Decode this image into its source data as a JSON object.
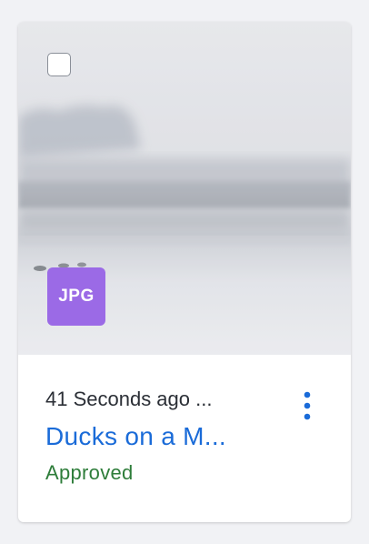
{
  "card": {
    "image_alt": "Ducks on a Misty Lake",
    "file_type_badge": "JPG",
    "timestamp": "41 Seconds ago ...",
    "title": "Ducks on a M...",
    "status": "Approved",
    "more_actions_icon": "vertical-ellipsis-icon"
  },
  "colors": {
    "badge_bg": "#9b6ae6",
    "title_link": "#1a6bd8",
    "status_approved": "#2e7d3a",
    "kebab": "#1a6bd8"
  }
}
